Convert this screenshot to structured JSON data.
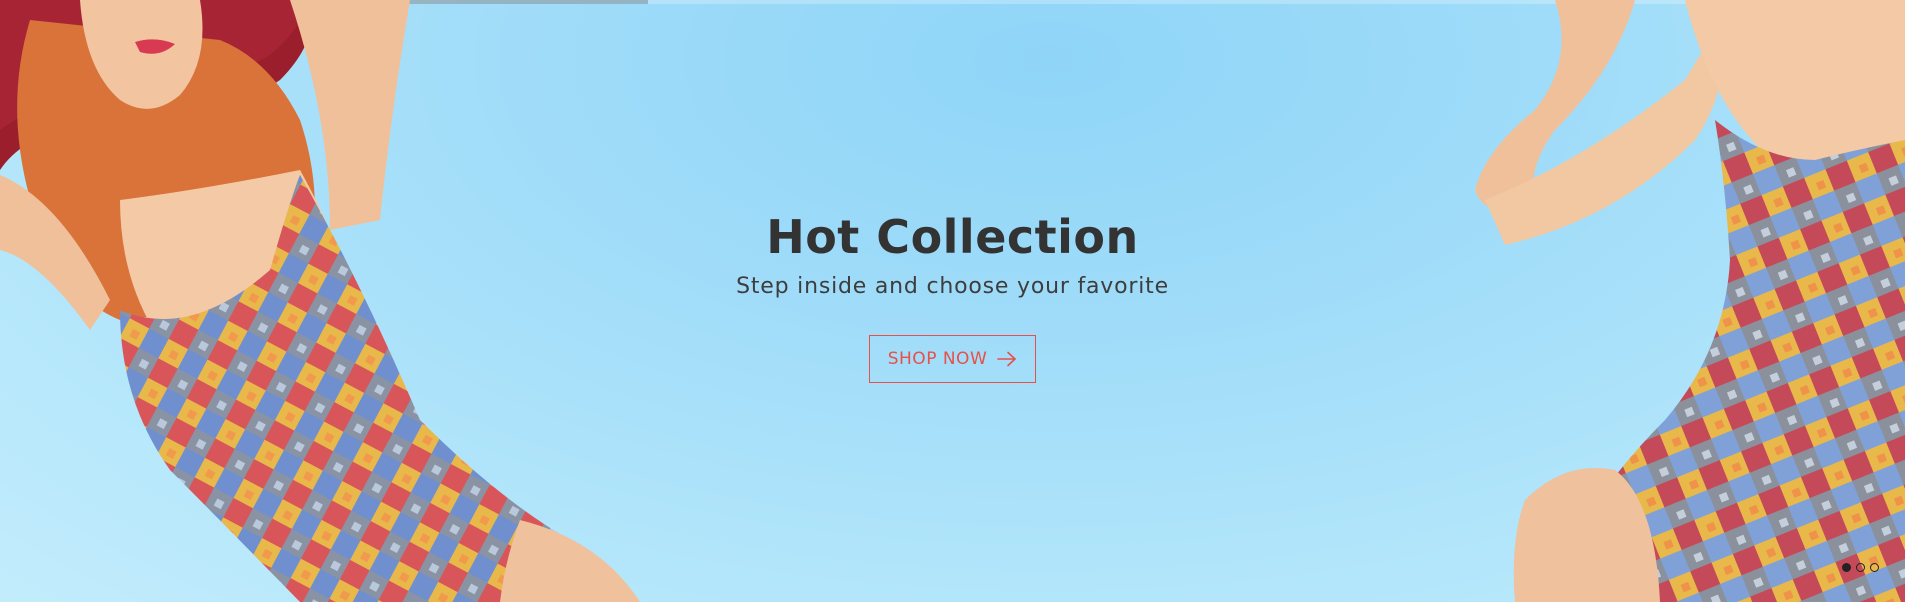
{
  "slider": {
    "progress": 0.34,
    "slide_count": 3,
    "active_slide": 0
  },
  "hero": {
    "title": "Hot Collection",
    "subtitle": "Step inside and choose your favorite",
    "cta": {
      "label": "SHOP NOW",
      "icon": "arrow-right-icon"
    },
    "colors": {
      "accent": "#e8504a",
      "title": "#333333",
      "background": "#a2ddf9"
    }
  },
  "images": {
    "left": "model-left-image",
    "right": "model-right-image"
  }
}
